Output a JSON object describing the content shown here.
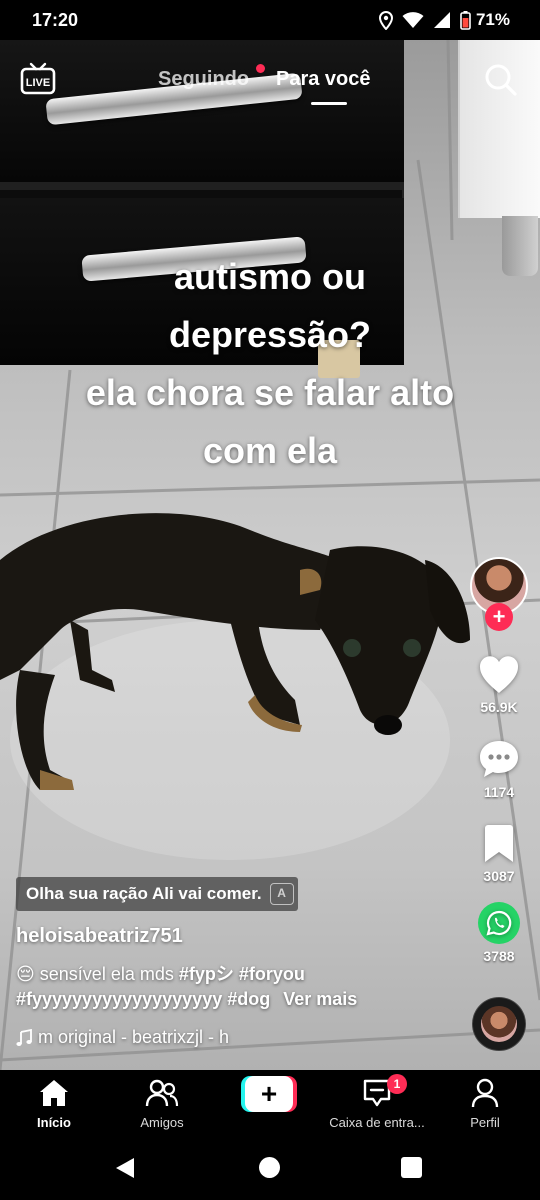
{
  "status_bar": {
    "time": "17:20",
    "battery": "71%",
    "icons": [
      "location-icon",
      "wifi-icon",
      "signal-icon",
      "battery-icon"
    ]
  },
  "top_nav": {
    "live_label": "LIVE",
    "tabs": [
      {
        "label": "Seguindo",
        "active": false,
        "has_dot": true
      },
      {
        "label": "Para você",
        "active": true
      }
    ]
  },
  "video": {
    "overlay_lines": [
      "autismo ou",
      "depressão?",
      "ela chora se falar alto",
      "com ela"
    ]
  },
  "actions": {
    "likes": "56.9K",
    "comments": "1174",
    "saves": "3087",
    "shares": "3788"
  },
  "post": {
    "translated_caption": "Olha sua ração Ali vai comer.",
    "username": "heloisabeatriz751",
    "description_emoji": "😔",
    "description_text": "sensível ela mds",
    "hashtags_line1": [
      "#fypシ",
      "#foryou"
    ],
    "hashtags_line2": [
      "#fyyyyyyyyyyyyyyyyyyy",
      "#dog"
    ],
    "more_label": "Ver mais",
    "sound": "m original - beatrixzjl - h"
  },
  "tabbar": {
    "items": [
      {
        "label": "Início",
        "active": true
      },
      {
        "label": "Amigos",
        "active": false
      },
      {
        "label": "Caixa de entra...",
        "active": false,
        "badge": "1"
      },
      {
        "label": "Perfil",
        "active": false
      }
    ]
  },
  "colors": {
    "accent": "#fe2c55",
    "accent_alt": "#25f4ee",
    "whatsapp": "#25d366"
  }
}
